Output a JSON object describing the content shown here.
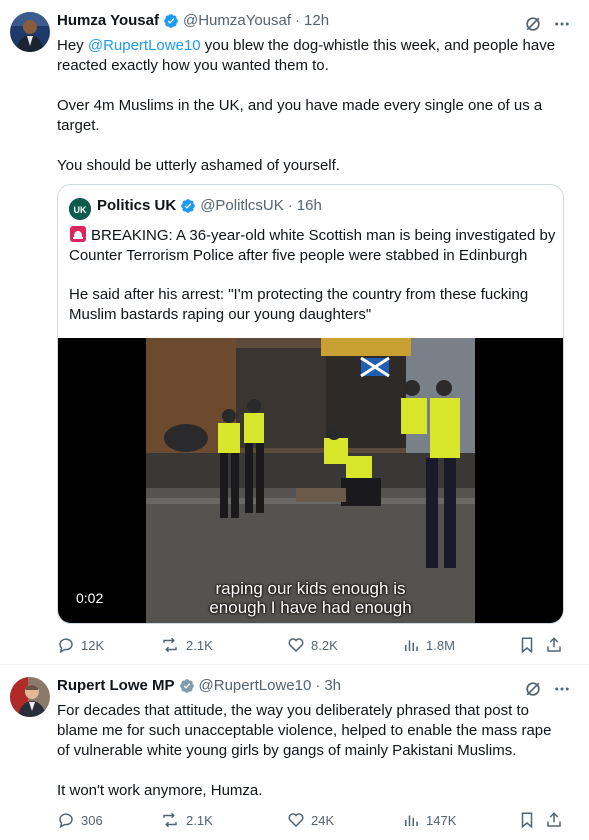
{
  "tweet1": {
    "author": "Humza Yousaf",
    "handle": "@HumzaYousaf",
    "time": "12h",
    "line1_pre": "Hey ",
    "mention": "@RupertLowe10",
    "line1_post": " you blew the dog-whistle this week, and people have",
    "line2": "reacted exactly how you wanted them to.",
    "para2": "Over 4m Muslims in the UK, and you have made every single one of us a target.",
    "para3": "You should be utterly ashamed of yourself.",
    "quote": {
      "author": "Politics UK",
      "handle": "@PolitlcsUK",
      "time": "16h",
      "avatar_text": "UK",
      "para1": "BREAKING: A 36-year-old white Scottish man is being investigated by Counter Terrorism Police after five people were stabbed in Edinburgh",
      "para2": "He said after his arrest: \"I'm protecting the country from these fucking Muslim bastards raping our young daughters\"",
      "video_time": "0:02",
      "subtitle1": "raping our kids enough is",
      "subtitle2": "enough I have had enough"
    },
    "stats": {
      "replies": "12K",
      "reposts": "2.1K",
      "likes": "8.2K",
      "views": "1.8M"
    }
  },
  "tweet2": {
    "author": "Rupert Lowe MP",
    "handle": "@RupertLowe10",
    "time": "3h",
    "para1": "For decades that attitude, the way you deliberately phrased that post to blame me for such unacceptable violence, helped to enable the mass rape of vulnerable white young girls by gangs of mainly Pakistani Muslims.",
    "para2": "It won't work anymore, Humza.",
    "stats": {
      "replies": "306",
      "reposts": "2.1K",
      "likes": "24K",
      "views": "147K"
    }
  },
  "separator": "·",
  "colors": {
    "link": "#1d9bf0",
    "verified": "#1d9bf0",
    "muted": "#536471",
    "text": "#0f1419"
  }
}
